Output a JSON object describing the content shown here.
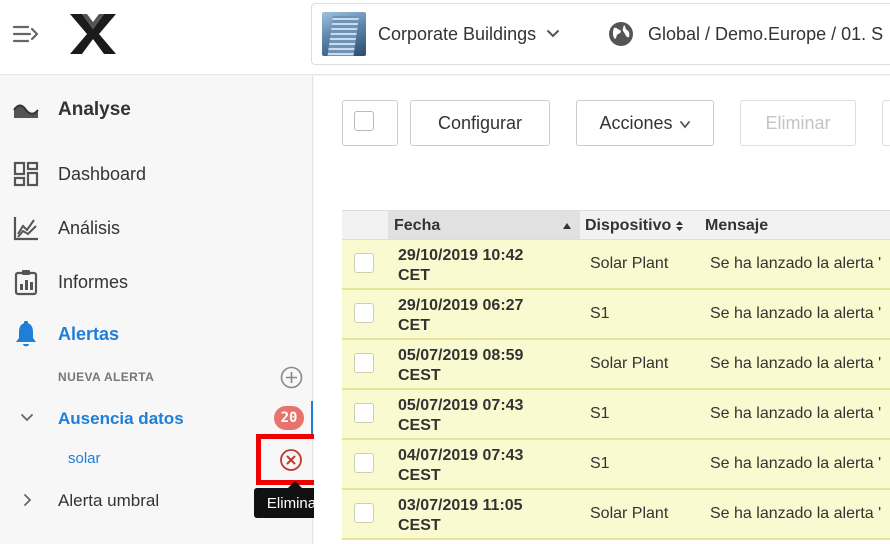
{
  "header": {
    "building": "Corporate Buildings",
    "location": "Global / Demo.Europe / 01. S"
  },
  "sidebar": {
    "title": "Analyse",
    "items": [
      {
        "label": "Dashboard"
      },
      {
        "label": "Análisis"
      },
      {
        "label": "Informes"
      },
      {
        "label": "Alertas"
      }
    ],
    "section_label": "NUEVA ALERTA",
    "alerts": [
      {
        "label": "Ausencia datos",
        "badge": "20"
      },
      {
        "label": "Alerta umbral"
      }
    ],
    "leaf": "solar",
    "tooltip": "Eliminar"
  },
  "toolbar": {
    "configure": "Configurar",
    "actions": "Acciones",
    "delete": "Eliminar"
  },
  "table": {
    "headers": {
      "date": "Fecha",
      "device": "Dispositivo",
      "message": "Mensaje"
    },
    "rows": [
      {
        "date": "29/10/2019 10:42",
        "tz": "CET",
        "device": "Solar Plant",
        "message": "Se ha lanzado la alerta '"
      },
      {
        "date": "29/10/2019 06:27",
        "tz": "CET",
        "device": "S1",
        "message": "Se ha lanzado la alerta '"
      },
      {
        "date": "05/07/2019 08:59",
        "tz": "CEST",
        "device": "Solar Plant",
        "message": "Se ha lanzado la alerta '"
      },
      {
        "date": "05/07/2019 07:43",
        "tz": "CEST",
        "device": "S1",
        "message": "Se ha lanzado la alerta '"
      },
      {
        "date": "04/07/2019 07:43",
        "tz": "CEST",
        "device": "S1",
        "message": "Se ha lanzado la alerta '"
      },
      {
        "date": "03/07/2019 11:05",
        "tz": "CEST",
        "device": "Solar Plant",
        "message": "Se ha lanzado la alerta '"
      }
    ]
  },
  "colors": {
    "accent": "#1f7fd6",
    "badge": "#e8736c",
    "row_highlight": "#fafad0",
    "highlight_box": "#ee0000"
  }
}
